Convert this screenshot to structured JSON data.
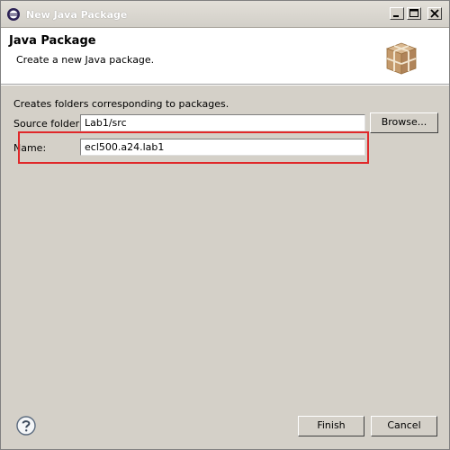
{
  "window": {
    "title": "New Java Package"
  },
  "header": {
    "title": "Java Package",
    "description": "Create a new Java package."
  },
  "body": {
    "intro": "Creates folders corresponding to packages.",
    "source_folder": {
      "label": "Source folder:",
      "value": "Lab1/src"
    },
    "browse_label": "Browse...",
    "name": {
      "label": "Name:",
      "value": "ecl500.a24.lab1"
    }
  },
  "footer": {
    "finish_label": "Finish",
    "cancel_label": "Cancel"
  },
  "icons": {
    "app": "eclipse-icon",
    "banner": "package-icon",
    "help": "help-icon"
  }
}
